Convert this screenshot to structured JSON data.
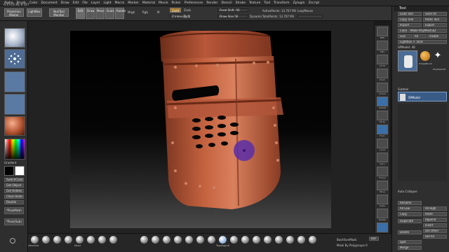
{
  "menu": {
    "items": [
      "Alpha",
      "Brush",
      "Color",
      "Document",
      "Draw",
      "Edit",
      "File",
      "Layer",
      "Light",
      "Macro",
      "Marker",
      "Material",
      "Movie",
      "Picker",
      "Preferences",
      "Render",
      "Stencil",
      "Stroke",
      "Texture",
      "Tool",
      "Transform",
      "Zplugin",
      "Zscript"
    ]
  },
  "toolbar": {
    "projection_master": "Projection Master",
    "lightbox": "LightBox",
    "quick_sketch": "NukTool Monitor",
    "coords": "-0.172,0.36,-0.527",
    "edit_btn": "Edit",
    "draw_btn": "Draw",
    "move_btn": "Move",
    "scale_btn": "Scale",
    "rotate_btn": "Rotate",
    "mrgb": "Mrgb",
    "rgb": "Rgb",
    "m": "M",
    "zadd": "Zadd",
    "zsub": "Zsub",
    "zcut": "Zcut",
    "z_intensity": "Z Intensity 5",
    "focal_shift": "Focal Shift -56",
    "draw_size": "Draw Size 56",
    "dynamic": "Dynamic",
    "active_points": "ActivePoints: 13.707 Mil",
    "total_points": "TotalPoints: 13.707 Mil",
    "lazy_mouse": "LazyMouse"
  },
  "left": {
    "gradient_label": "Gradient",
    "switch_color": "SwitchColor",
    "buttons": [
      "Get Object",
      "Get Hidden",
      "Close Holes",
      "Double"
    ],
    "pose1": "*PoseMesh",
    "pose2": "*Pose(Sub)"
  },
  "right": {
    "title": "Tool",
    "buttons_row1": [
      "Load Tool",
      "Save As"
    ],
    "buttons_row2": [
      "Copy Tool",
      "Paste Tool"
    ],
    "buttons_row3": [
      "Import",
      "Export"
    ],
    "buttons_row4": [
      "Clone",
      "Make PolyMesh3D"
    ],
    "buttons_row5": [
      "GoZ",
      "All",
      "Visible"
    ],
    "lightbox_tools": "Lightbox > Tools",
    "current_tool": "SPModel: 48",
    "tool_thumbs": [
      "SPModel",
      "SimpleBrush",
      "PolyMesh3D"
    ],
    "subtool_header": "Subtool",
    "subtool_item": "SPModel",
    "auto_collapse": "Auto Collapse",
    "bottom_buttons": [
      [
        "Rename",
        ""
      ],
      [
        "All Low",
        "All High"
      ],
      [
        "Copy",
        "Paste"
      ],
      [
        "Duplicate",
        "Append"
      ],
      [
        "",
        "Insert"
      ],
      [
        "Delete",
        "Del Other"
      ],
      [
        "",
        "Del All"
      ],
      [
        "Split",
        ""
      ],
      [
        "Merge",
        ""
      ]
    ]
  },
  "right_shelf": [
    "BPR",
    "SPix",
    "Scroll",
    "Zoom",
    "Actual",
    "AAHalf",
    "Persp",
    "Floor",
    "Local",
    "Gyro",
    "Frame",
    "Move",
    "Scale",
    "Rotate",
    "PolyF",
    "Transp",
    "Solo",
    "Xpose"
  ],
  "bottom": {
    "brushes": [
      "Selected",
      "SelectRect",
      "Clay",
      "Standard",
      "Move",
      "Move Topo",
      "Dam_Standard",
      "Inflate",
      "TrimDynamic",
      "hPolish",
      "ClayBuildup",
      "SnakeHook",
      "Pinch",
      "Orb_Cracks",
      "Orb_Flatten",
      "Orb_Clay",
      "Orb_Slash",
      "Orb_Rock",
      "Topological",
      "Orb_Wrinkles",
      "Mask",
      "Clip",
      "Orb_Brush",
      "Orb_Lines",
      "Orb_Tubes",
      "Clip Curve",
      "Chisel"
    ],
    "backface": "BackfaceMask",
    "topological": "Topological",
    "mask_by_poly": "Mask By Polygroups 0",
    "del": "Del"
  }
}
